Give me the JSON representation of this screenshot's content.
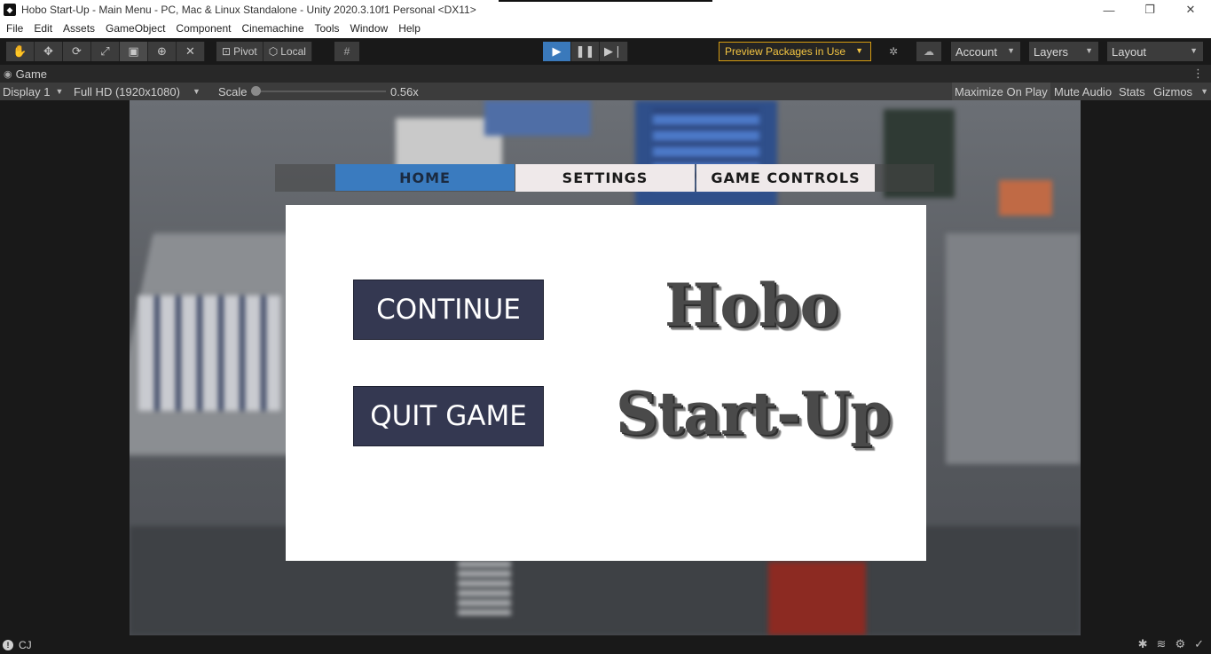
{
  "window": {
    "title": "Hobo Start-Up - Main Menu - PC, Mac & Linux Standalone - Unity 2020.3.10f1 Personal <DX11>",
    "minimize": "—",
    "restore": "❐",
    "close": "✕"
  },
  "menubar": [
    "File",
    "Edit",
    "Assets",
    "GameObject",
    "Component",
    "Cinemachine",
    "Tools",
    "Window",
    "Help"
  ],
  "toolbar": {
    "tools": [
      "hand-icon",
      "move-icon",
      "rotate-icon",
      "scale-icon",
      "rect-icon",
      "transform-icon",
      "custom-tool-icon"
    ],
    "pivot_label": "Pivot",
    "local_label": "Local",
    "preview_packages_label": "Preview Packages in Use",
    "account_label": "Account",
    "layers_label": "Layers",
    "layout_label": "Layout",
    "play_state": "playing"
  },
  "game_tab": {
    "label": "Game"
  },
  "game_toolbar": {
    "display": "Display 1",
    "resolution": "Full HD (1920x1080)",
    "scale_label": "Scale",
    "scale_value": "0.56x",
    "maximize_on_play": "Maximize On Play",
    "mute_audio": "Mute Audio",
    "stats": "Stats",
    "gizmos": "Gizmos"
  },
  "game": {
    "tabs": [
      "HOME",
      "SETTINGS",
      "GAME CONTROLS"
    ],
    "selected_tab": "HOME",
    "continue_label": "CONTINUE",
    "quit_label": "QUIT GAME",
    "logo_line1": "Hobo",
    "logo_line2": "Start-Up",
    "colors": {
      "tab_active": "#3a7bbf",
      "tab_inactive": "#efe9ea",
      "button_bg": "#343851",
      "panel_bg": "#ffffff"
    }
  },
  "statusbar": {
    "text": "CJ"
  }
}
